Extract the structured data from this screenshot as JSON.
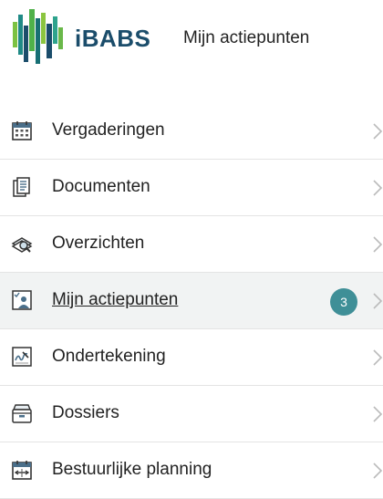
{
  "header": {
    "brand": "iBABS",
    "title": "Mijn actiepunten"
  },
  "nav": {
    "items": [
      {
        "label": "Vergaderingen",
        "icon": "calendar-icon"
      },
      {
        "label": "Documenten",
        "icon": "documents-icon"
      },
      {
        "label": "Overzichten",
        "icon": "overview-search-icon"
      },
      {
        "label": "Mijn actiepunten",
        "icon": "action-items-icon",
        "badge": "3",
        "active": true
      },
      {
        "label": "Ondertekening",
        "icon": "signature-icon"
      },
      {
        "label": "Dossiers",
        "icon": "archive-box-icon"
      },
      {
        "label": "Bestuurlijke planning",
        "icon": "planning-calendar-icon"
      }
    ]
  },
  "colors": {
    "brand": "#1b4d6b",
    "badge": "#3f8f97",
    "active_bg": "#f1f3f3"
  }
}
